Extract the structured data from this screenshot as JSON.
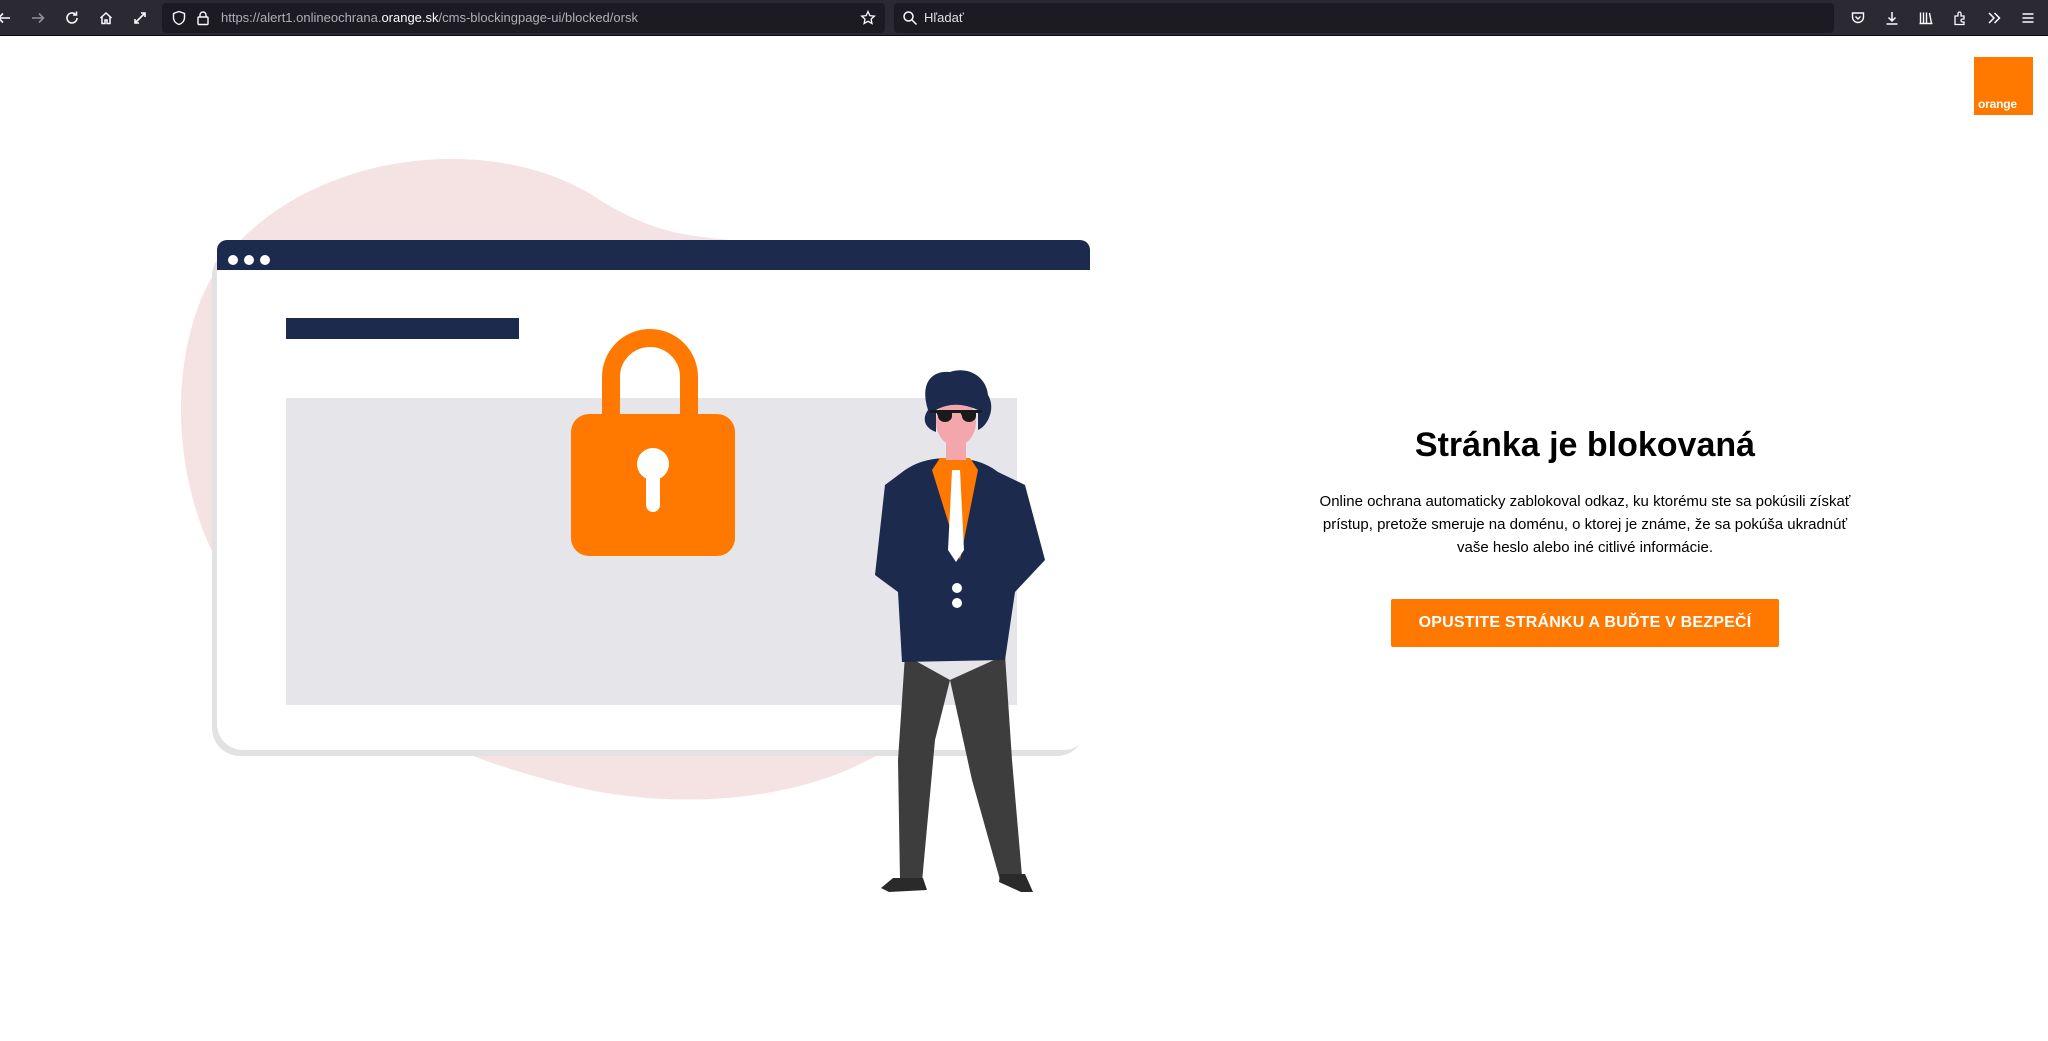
{
  "browser": {
    "url": {
      "prefix": "https://alert1.onlineochrana.",
      "host": "orange.sk",
      "path": "/cms-blockingpage-ui/blocked/orsk"
    },
    "search_placeholder": "Hľadať",
    "icons": [
      "back-icon",
      "forward-icon",
      "reload-icon",
      "home-icon",
      "fullscreen-icon",
      "shield-icon",
      "lock-icon",
      "bookmark-star-icon",
      "search-icon",
      "pocket-icon",
      "download-icon",
      "library-icon",
      "extensions-icon",
      "overflow-icon",
      "menu-icon"
    ]
  },
  "brand": {
    "logo_text": "orange",
    "accent": "#ff7900",
    "navy": "#1c2a4e"
  },
  "main": {
    "title": "Stránka je blokovaná",
    "description": "Online ochrana automaticky zablokoval odkaz, ku ktorému ste sa pokúsili získať prístup, pretože smeruje na doménu, o ktorej je známe, že sa pokúša ukradnúť vaše heslo alebo iné citlivé informácie.",
    "button_label": "OPUSTITE STRÁNKU A BUĎTE V BEZPEČÍ"
  }
}
